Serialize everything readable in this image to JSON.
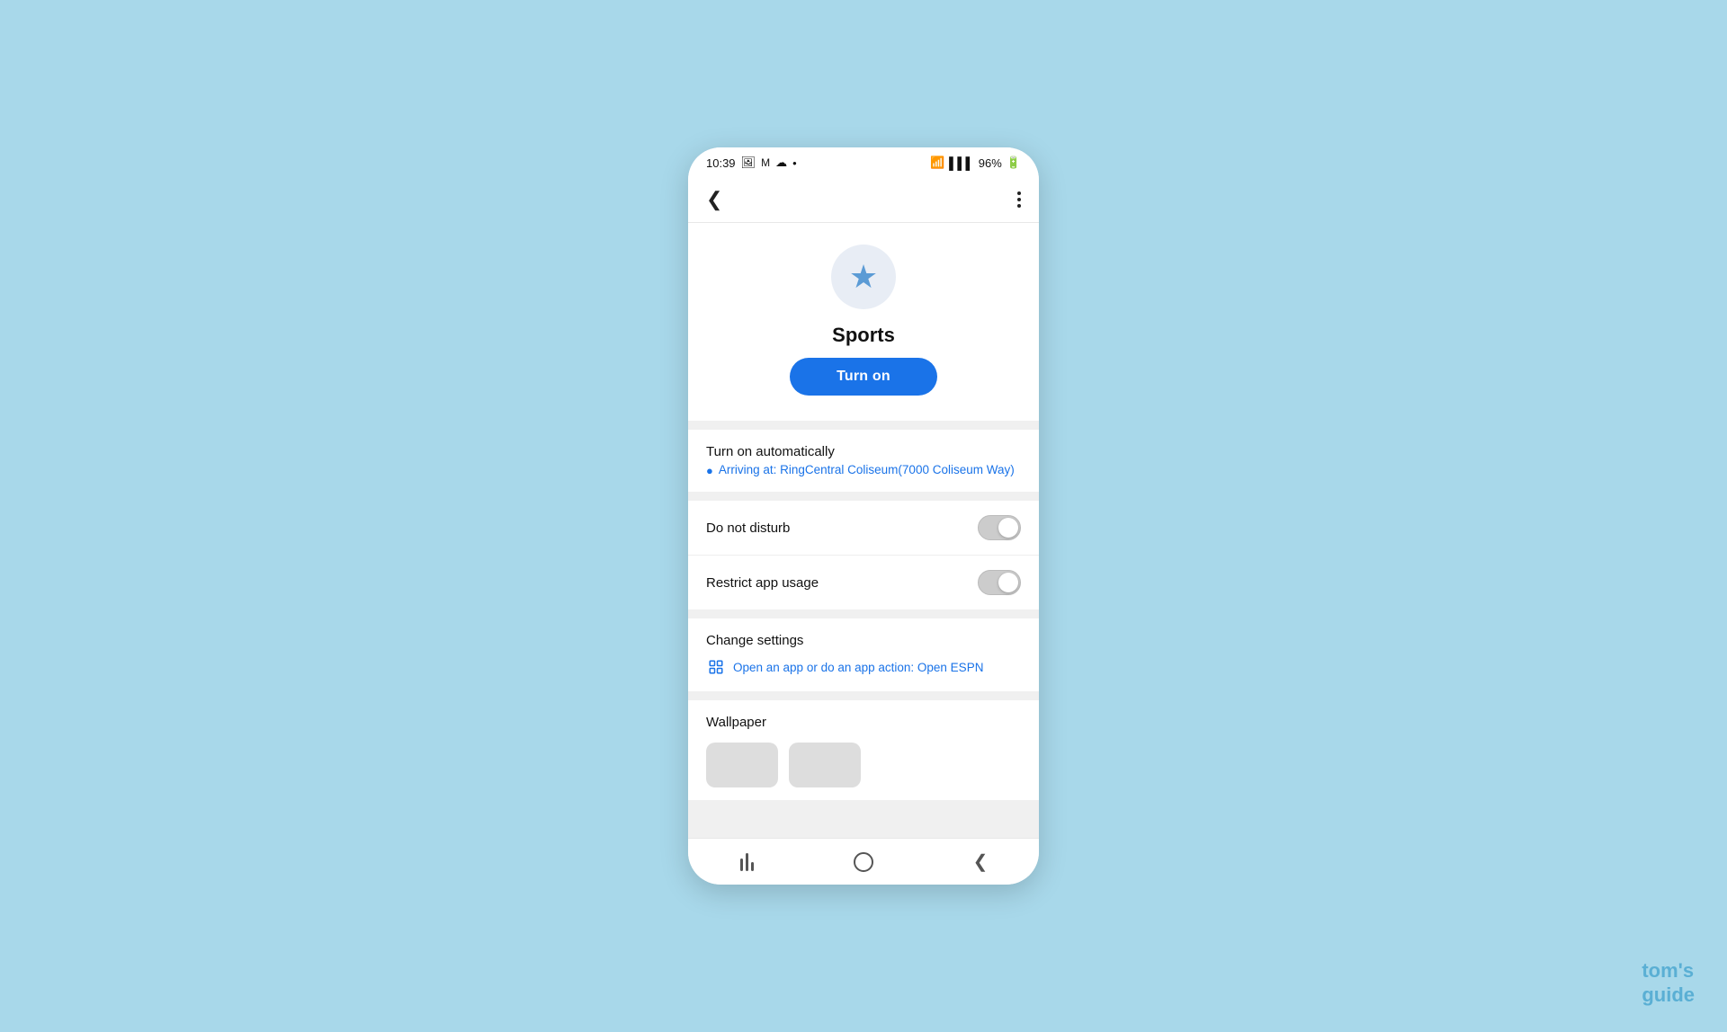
{
  "statusBar": {
    "time": "10:39",
    "battery": "96%",
    "icons": [
      "photo",
      "mail",
      "cloud",
      "dot"
    ]
  },
  "header": {
    "backLabel": "‹",
    "moreLabel": "⋮"
  },
  "hero": {
    "appName": "Sports",
    "turnOnLabel": "Turn on",
    "iconColor": "#5b9bd5",
    "iconBg": "#e8edf5"
  },
  "turnOnAutomatically": {
    "sectionTitle": "Turn on automatically",
    "locationText": "Arriving at: RingCentral Coliseum(7000 Coliseum Way)"
  },
  "toggles": [
    {
      "label": "Do not disturb",
      "enabled": false
    },
    {
      "label": "Restrict app usage",
      "enabled": false
    }
  ],
  "changeSettings": {
    "sectionTitle": "Change settings",
    "actionText": "Open an app or do an app action: Open ESPN"
  },
  "wallpaper": {
    "sectionTitle": "Wallpaper"
  },
  "bottomNav": {
    "items": [
      "recents",
      "home",
      "back"
    ]
  },
  "watermark": {
    "line1": "tom's",
    "line2": "guide"
  }
}
